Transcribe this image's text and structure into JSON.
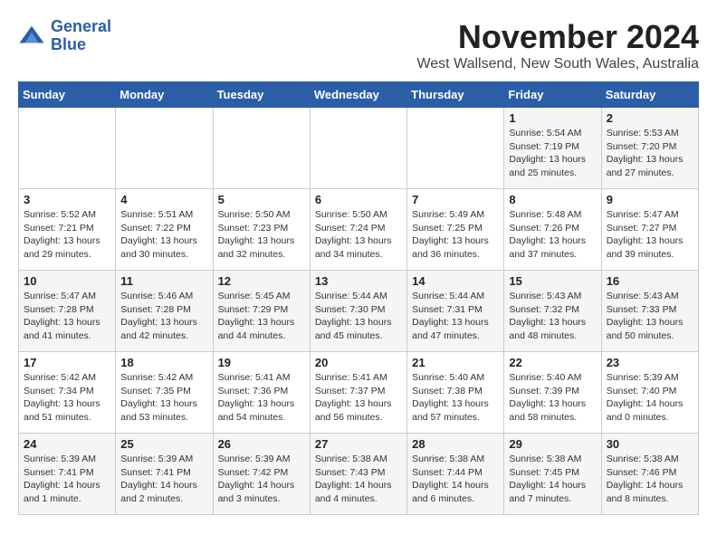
{
  "logo": {
    "line1": "General",
    "line2": "Blue"
  },
  "title": "November 2024",
  "location": "West Wallsend, New South Wales, Australia",
  "weekdays": [
    "Sunday",
    "Monday",
    "Tuesday",
    "Wednesday",
    "Thursday",
    "Friday",
    "Saturday"
  ],
  "weeks": [
    [
      {
        "day": "",
        "info": ""
      },
      {
        "day": "",
        "info": ""
      },
      {
        "day": "",
        "info": ""
      },
      {
        "day": "",
        "info": ""
      },
      {
        "day": "",
        "info": ""
      },
      {
        "day": "1",
        "info": "Sunrise: 5:54 AM\nSunset: 7:19 PM\nDaylight: 13 hours\nand 25 minutes."
      },
      {
        "day": "2",
        "info": "Sunrise: 5:53 AM\nSunset: 7:20 PM\nDaylight: 13 hours\nand 27 minutes."
      }
    ],
    [
      {
        "day": "3",
        "info": "Sunrise: 5:52 AM\nSunset: 7:21 PM\nDaylight: 13 hours\nand 29 minutes."
      },
      {
        "day": "4",
        "info": "Sunrise: 5:51 AM\nSunset: 7:22 PM\nDaylight: 13 hours\nand 30 minutes."
      },
      {
        "day": "5",
        "info": "Sunrise: 5:50 AM\nSunset: 7:23 PM\nDaylight: 13 hours\nand 32 minutes."
      },
      {
        "day": "6",
        "info": "Sunrise: 5:50 AM\nSunset: 7:24 PM\nDaylight: 13 hours\nand 34 minutes."
      },
      {
        "day": "7",
        "info": "Sunrise: 5:49 AM\nSunset: 7:25 PM\nDaylight: 13 hours\nand 36 minutes."
      },
      {
        "day": "8",
        "info": "Sunrise: 5:48 AM\nSunset: 7:26 PM\nDaylight: 13 hours\nand 37 minutes."
      },
      {
        "day": "9",
        "info": "Sunrise: 5:47 AM\nSunset: 7:27 PM\nDaylight: 13 hours\nand 39 minutes."
      }
    ],
    [
      {
        "day": "10",
        "info": "Sunrise: 5:47 AM\nSunset: 7:28 PM\nDaylight: 13 hours\nand 41 minutes."
      },
      {
        "day": "11",
        "info": "Sunrise: 5:46 AM\nSunset: 7:28 PM\nDaylight: 13 hours\nand 42 minutes."
      },
      {
        "day": "12",
        "info": "Sunrise: 5:45 AM\nSunset: 7:29 PM\nDaylight: 13 hours\nand 44 minutes."
      },
      {
        "day": "13",
        "info": "Sunrise: 5:44 AM\nSunset: 7:30 PM\nDaylight: 13 hours\nand 45 minutes."
      },
      {
        "day": "14",
        "info": "Sunrise: 5:44 AM\nSunset: 7:31 PM\nDaylight: 13 hours\nand 47 minutes."
      },
      {
        "day": "15",
        "info": "Sunrise: 5:43 AM\nSunset: 7:32 PM\nDaylight: 13 hours\nand 48 minutes."
      },
      {
        "day": "16",
        "info": "Sunrise: 5:43 AM\nSunset: 7:33 PM\nDaylight: 13 hours\nand 50 minutes."
      }
    ],
    [
      {
        "day": "17",
        "info": "Sunrise: 5:42 AM\nSunset: 7:34 PM\nDaylight: 13 hours\nand 51 minutes."
      },
      {
        "day": "18",
        "info": "Sunrise: 5:42 AM\nSunset: 7:35 PM\nDaylight: 13 hours\nand 53 minutes."
      },
      {
        "day": "19",
        "info": "Sunrise: 5:41 AM\nSunset: 7:36 PM\nDaylight: 13 hours\nand 54 minutes."
      },
      {
        "day": "20",
        "info": "Sunrise: 5:41 AM\nSunset: 7:37 PM\nDaylight: 13 hours\nand 56 minutes."
      },
      {
        "day": "21",
        "info": "Sunrise: 5:40 AM\nSunset: 7:38 PM\nDaylight: 13 hours\nand 57 minutes."
      },
      {
        "day": "22",
        "info": "Sunrise: 5:40 AM\nSunset: 7:39 PM\nDaylight: 13 hours\nand 58 minutes."
      },
      {
        "day": "23",
        "info": "Sunrise: 5:39 AM\nSunset: 7:40 PM\nDaylight: 14 hours\nand 0 minutes."
      }
    ],
    [
      {
        "day": "24",
        "info": "Sunrise: 5:39 AM\nSunset: 7:41 PM\nDaylight: 14 hours\nand 1 minute."
      },
      {
        "day": "25",
        "info": "Sunrise: 5:39 AM\nSunset: 7:41 PM\nDaylight: 14 hours\nand 2 minutes."
      },
      {
        "day": "26",
        "info": "Sunrise: 5:39 AM\nSunset: 7:42 PM\nDaylight: 14 hours\nand 3 minutes."
      },
      {
        "day": "27",
        "info": "Sunrise: 5:38 AM\nSunset: 7:43 PM\nDaylight: 14 hours\nand 4 minutes."
      },
      {
        "day": "28",
        "info": "Sunrise: 5:38 AM\nSunset: 7:44 PM\nDaylight: 14 hours\nand 6 minutes."
      },
      {
        "day": "29",
        "info": "Sunrise: 5:38 AM\nSunset: 7:45 PM\nDaylight: 14 hours\nand 7 minutes."
      },
      {
        "day": "30",
        "info": "Sunrise: 5:38 AM\nSunset: 7:46 PM\nDaylight: 14 hours\nand 8 minutes."
      }
    ]
  ]
}
